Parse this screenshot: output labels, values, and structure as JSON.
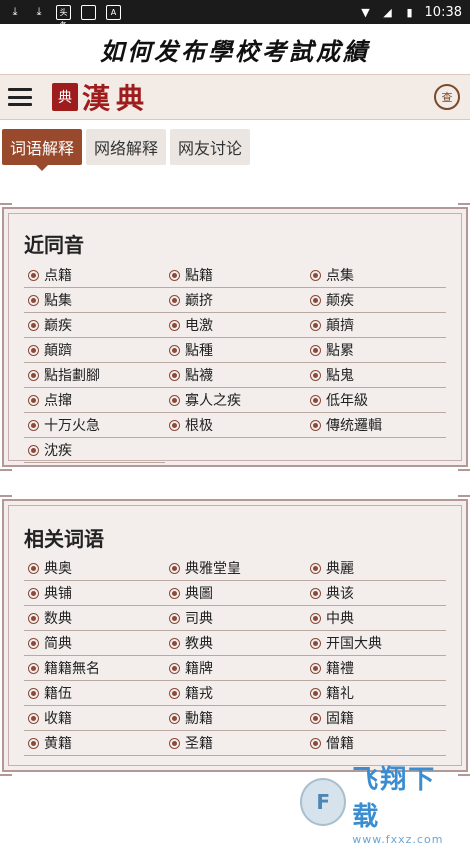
{
  "status_bar": {
    "left_icons": [
      "download-icon",
      "download-icon",
      "app-icon",
      "square-icon",
      "a-icon"
    ],
    "app_badge": "头条",
    "a_badge": "A",
    "time": "10:38"
  },
  "page_title": "如何发布學校考試成績",
  "navbar": {
    "logo_seal": "典",
    "logo_text": "漢典",
    "right_icon": "查"
  },
  "tabs": [
    {
      "label": "词语解释",
      "active": true
    },
    {
      "label": "网络解释",
      "active": false
    },
    {
      "label": "网友讨论",
      "active": false
    }
  ],
  "section_near_sound": {
    "title": "近同音",
    "items": [
      "点籍",
      "點籍",
      "点集",
      "點集",
      "巅挤",
      "颠疾",
      "巅疾",
      "电激",
      "顛擠",
      "顛躋",
      "點種",
      "點累",
      "點指劃腳",
      "點襪",
      "點鬼",
      "点撺",
      "寡人之疾",
      "低年級",
      "十万火急",
      "根极",
      "傳统邏輯",
      "沈疾"
    ]
  },
  "section_related": {
    "title": "相关词语",
    "items": [
      "典奥",
      "典雅堂皇",
      "典麗",
      "典铺",
      "典圖",
      "典该",
      "数典",
      "司典",
      "中典",
      "简典",
      "教典",
      "开国大典",
      "籍籍無名",
      "籍牌",
      "籍禮",
      "籍伍",
      "籍戎",
      "籍礼",
      "收籍",
      "勳籍",
      "固籍",
      "黄籍",
      "圣籍",
      "僧籍"
    ]
  },
  "watermark": {
    "main": "飞翔下载",
    "sub": "www.fxxz.com"
  },
  "colors": {
    "accent": "#9a4a2c",
    "logo_red": "#9e1c1c",
    "card_bg": "#f3eeec",
    "card_border": "#b39898"
  }
}
